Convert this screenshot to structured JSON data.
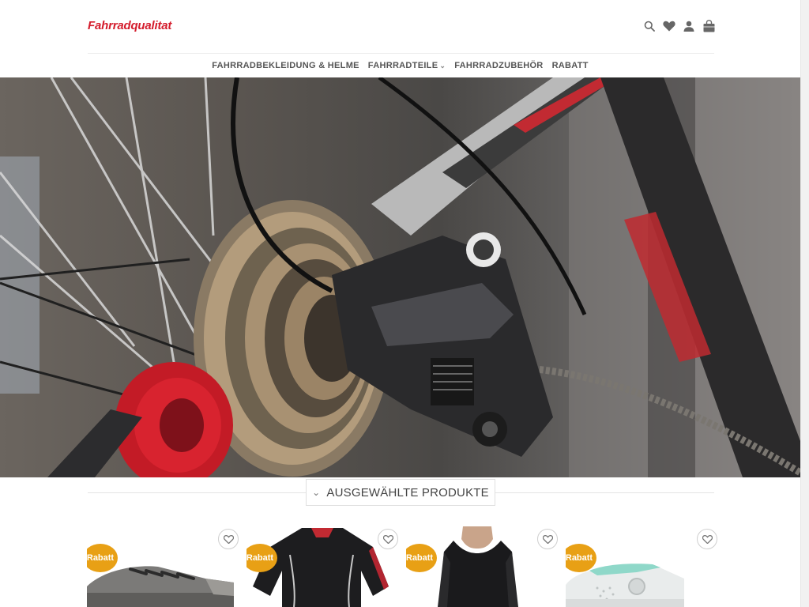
{
  "header": {
    "logo": "Fahrradqualitat",
    "icons": [
      "search-icon",
      "heart-icon",
      "user-icon",
      "shopping-bag-icon"
    ]
  },
  "nav": {
    "items": [
      {
        "label": "FAHRRADBEKLEIDUNG & HELME",
        "has_dropdown": false
      },
      {
        "label": "FAHRRADTEILE",
        "has_dropdown": true
      },
      {
        "label": "FAHRRADZUBEHÖR",
        "has_dropdown": false
      },
      {
        "label": "RABATT",
        "has_dropdown": false
      }
    ]
  },
  "section": {
    "title": "AUSGEWÄHLTE PRODUKTE"
  },
  "products": [
    {
      "badge": "Rabatt",
      "image": "grey-cycling-shoe"
    },
    {
      "badge": "Rabatt",
      "image": "black-cycling-jersey"
    },
    {
      "badge": "Rabatt",
      "image": "black-long-sleeve-top"
    },
    {
      "badge": "Rabatt",
      "image": "white-cycling-shoe"
    }
  ],
  "colors": {
    "brand": "#d41c2c",
    "badge": "#e8a015"
  }
}
